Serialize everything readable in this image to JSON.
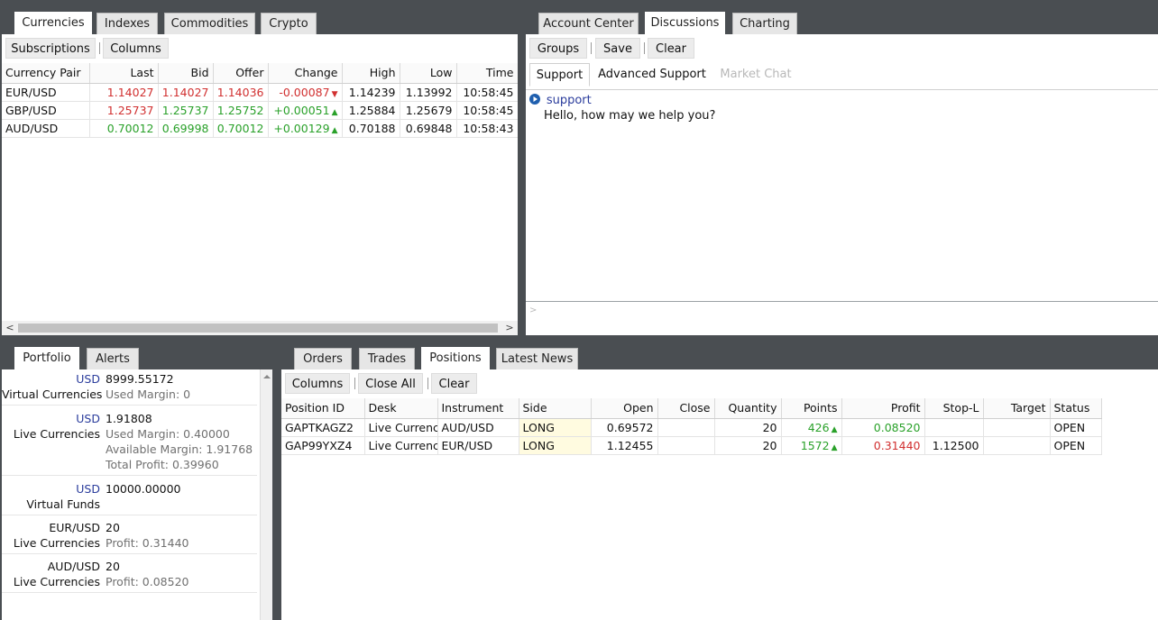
{
  "market": {
    "tabs": [
      "Currencies",
      "Indexes",
      "Commodities",
      "Crypto"
    ],
    "toolbar": {
      "subscriptions": "Subscriptions",
      "columns": "Columns"
    },
    "columns": [
      "Currency Pair",
      "Last",
      "Bid",
      "Offer",
      "Change",
      "High",
      "Low",
      "Time"
    ],
    "rows": [
      {
        "pair": "EUR/USD",
        "last": "1.14027",
        "bid": "1.14027",
        "offer": "1.14036",
        "change": "-0.00087",
        "arrow": "▼",
        "high": "1.14239",
        "low": "1.13992",
        "time": "10:58:45"
      },
      {
        "pair": "GBP/USD",
        "last": "1.25737",
        "bid": "1.25737",
        "offer": "1.25752",
        "change": "+0.00051",
        "arrow": "▲",
        "high": "1.25884",
        "low": "1.25679",
        "time": "10:58:45"
      },
      {
        "pair": "AUD/USD",
        "last": "0.70012",
        "bid": "0.69998",
        "offer": "0.70012",
        "change": "+0.00129",
        "arrow": "▲",
        "high": "0.70188",
        "low": "0.69848",
        "time": "10:58:43"
      }
    ],
    "scroll": {
      "left": "<",
      "right": ">"
    }
  },
  "discussions": {
    "tabs": [
      "Account Center",
      "Discussions",
      "Charting"
    ],
    "toolbar": {
      "groups": "Groups",
      "save": "Save",
      "clear": "Clear"
    },
    "subtabs": [
      "Support",
      "Advanced Support",
      "Market Chat"
    ],
    "message": {
      "sender": "support",
      "text": "Hello, how may we help you?"
    },
    "prompt": ">"
  },
  "portfolio": {
    "tabs": [
      "Portfolio",
      "Alerts"
    ],
    "entries": [
      {
        "currency": "USD",
        "name": "Virtual Currencies",
        "value": "8999.55172",
        "details": [
          "Used Margin:  0"
        ]
      },
      {
        "currency": "USD",
        "name": "Live Currencies",
        "value": "1.91808",
        "details": [
          "Used Margin:  0.40000",
          "Available Margin:  1.91768",
          "Total Profit:  0.39960"
        ]
      },
      {
        "currency": "USD",
        "name": "Virtual Funds",
        "value": "10000.00000",
        "details": []
      },
      {
        "currency": "EUR/USD",
        "name": "Live Currencies",
        "value": "20",
        "details": [
          "Profit:  0.31440"
        ]
      },
      {
        "currency": "AUD/USD",
        "name": "Live Currencies",
        "value": "20",
        "details": [
          "Profit:  0.08520"
        ]
      }
    ]
  },
  "positions": {
    "tabs": [
      "Orders",
      "Trades",
      "Positions",
      "Latest News"
    ],
    "toolbar": {
      "columns": "Columns",
      "close_all": "Close All",
      "clear": "Clear"
    },
    "columns": [
      "Position ID",
      "Desk",
      "Instrument",
      "Side",
      "Open",
      "Close",
      "Quantity",
      "Points",
      "Profit",
      "Stop-L",
      "Target",
      "Status"
    ],
    "rows": [
      {
        "id": "GAPTKAGZ2",
        "desk": "Live Currencies",
        "instrument": "AUD/USD",
        "side": "LONG",
        "open": "0.69572",
        "close": "",
        "quantity": "20",
        "points": "426",
        "arrow": "▲",
        "profit": "0.08520",
        "stop": "",
        "target": "",
        "status": "OPEN"
      },
      {
        "id": "GAP99YXZ4",
        "desk": "Live Currencies",
        "instrument": "EUR/USD",
        "side": "LONG",
        "open": "1.12455",
        "close": "",
        "quantity": "20",
        "points": "1572",
        "arrow": "▲",
        "profit": "0.31440",
        "stop": "1.12500",
        "target": "",
        "status": "OPEN"
      }
    ]
  },
  "colors": {
    "background": "#4a4e52",
    "up": "#2aa12a",
    "down": "#d13030",
    "accent": "#2a3c9c",
    "long_cell": "#fffbe0"
  }
}
